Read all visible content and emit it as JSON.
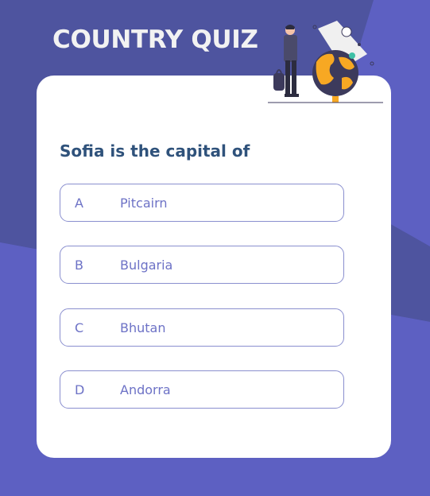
{
  "app": {
    "title": "COUNTRY QUIZ"
  },
  "quiz": {
    "question": "Sofia is the capital of",
    "options": [
      {
        "letter": "A",
        "text": "Pitcairn"
      },
      {
        "letter": "B",
        "text": "Bulgaria"
      },
      {
        "letter": "C",
        "text": "Bhutan"
      },
      {
        "letter": "D",
        "text": "Andorra"
      }
    ]
  },
  "colors": {
    "background": "#5d60c2",
    "background_dark": "#4e549f",
    "title": "#f2f2f2",
    "question": "#2f527b",
    "option_text": "#6d72c6",
    "option_border": "#8a8fcf",
    "globe": "#f7a823",
    "globe_dark": "#3c3a5c"
  },
  "icons": {
    "illustration": "person-with-globe-illustration"
  }
}
